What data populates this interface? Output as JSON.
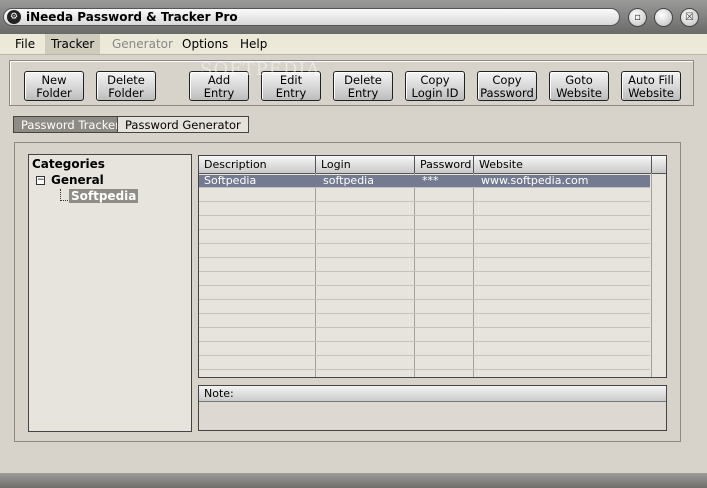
{
  "window": {
    "title": "iNeeda Password & Tracker Pro",
    "icon": "app-logo-icon",
    "controls": [
      "minimize-icon",
      "restore-icon",
      "close-icon"
    ]
  },
  "menu": {
    "file": "File",
    "tracker": "Tracker",
    "generator": "Generator",
    "options": "Options",
    "help": "Help"
  },
  "toolbar": {
    "new_folder": "New\nFolder",
    "delete_folder": "Delete\nFolder",
    "add_entry": "Add\nEntry",
    "edit_entry": "Edit\nEntry",
    "delete_entry": "Delete\nEntry",
    "copy_login_id": "Copy\nLogin ID",
    "copy_password": "Copy\nPassword",
    "goto_website": "Goto\nWebsite",
    "auto_fill_website": "Auto Fill\nWebsite"
  },
  "watermark": "SOFTPEDIA",
  "tabs": {
    "password_tracker": "Password Tracker",
    "password_generator": "Password Generator"
  },
  "tree": {
    "root": "Categories",
    "group": "General",
    "item": "Softpedia"
  },
  "grid": {
    "columns": {
      "description": "Description",
      "login": "Login",
      "password": "Password",
      "website": "Website"
    },
    "rows": [
      {
        "description": "Softpedia",
        "login": "softpedia",
        "password": "***",
        "website": "www.softpedia.com"
      }
    ]
  },
  "note": {
    "label": "Note:"
  },
  "colors": {
    "selection": "#747b90",
    "panel": "#d7d3ca",
    "menubar": "#ece9d8"
  }
}
